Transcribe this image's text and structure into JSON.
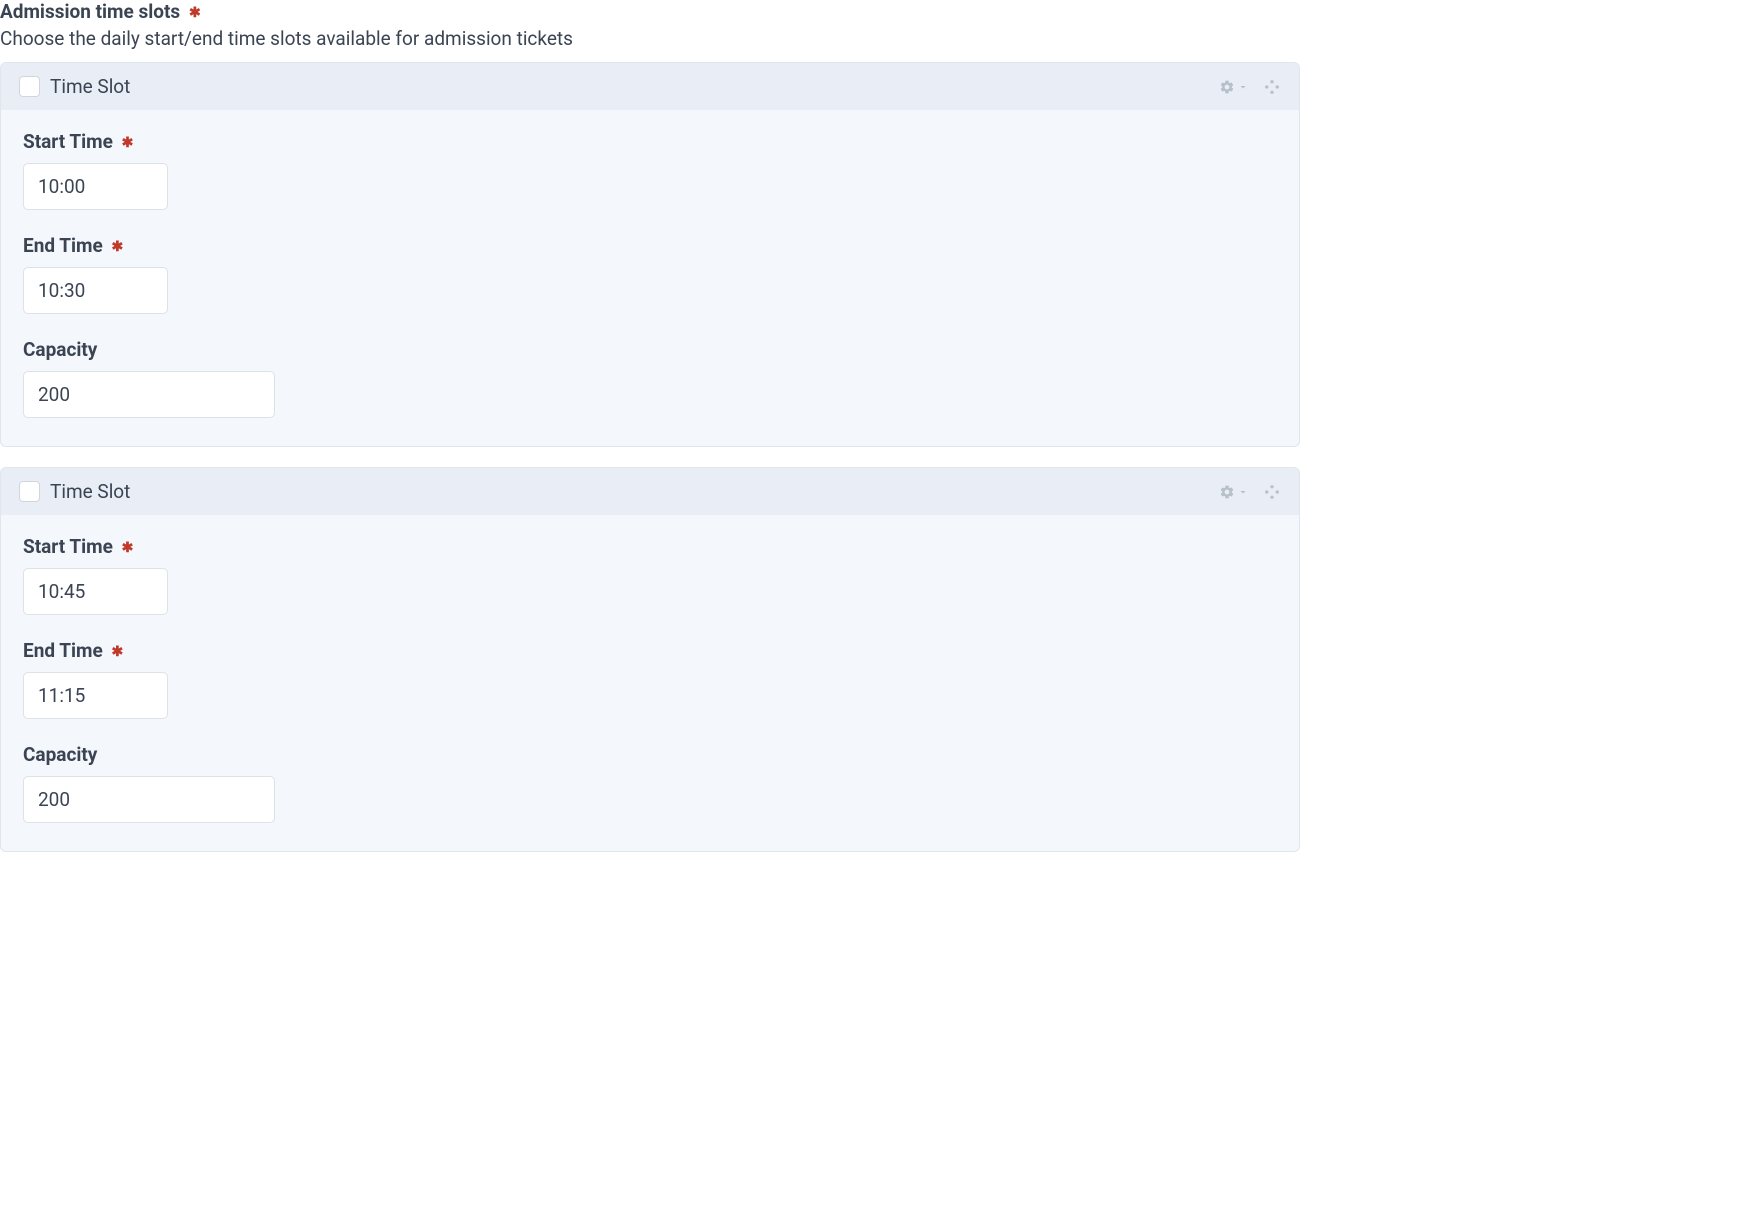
{
  "section": {
    "title": "Admission time slots",
    "description": "Choose the daily start/end time slots available for admission tickets"
  },
  "labels": {
    "time_slot": "Time Slot",
    "start_time": "Start Time",
    "end_time": "End Time",
    "capacity": "Capacity"
  },
  "slots": [
    {
      "start_time": "10:00",
      "end_time": "10:30",
      "capacity": "200"
    },
    {
      "start_time": "10:45",
      "end_time": "11:15",
      "capacity": "200"
    }
  ]
}
